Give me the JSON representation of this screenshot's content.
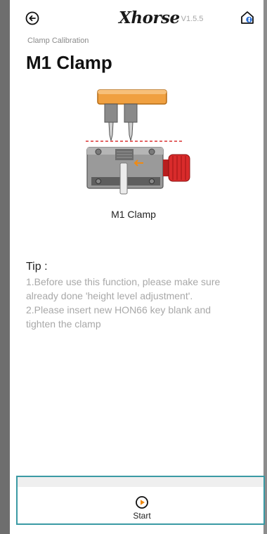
{
  "header": {
    "brand": "Xhorse",
    "version": "V1.5.5",
    "back_icon": "back-arrow-circle-icon",
    "home_icon": "home-bluetooth-icon"
  },
  "page": {
    "subtitle": "Clamp Calibration",
    "title": "M1 Clamp"
  },
  "illustration": {
    "caption": "M1 Clamp"
  },
  "tip": {
    "title": "Tip :",
    "lines": [
      "1.Before use this function, please make sure",
      "already done 'height level adjustment'.",
      "2.Please insert new HON66 key blank and",
      "tighten the clamp"
    ]
  },
  "bottom": {
    "start_label": "Start",
    "start_icon": "play-circle-icon",
    "accent_color": "#f08a12"
  }
}
